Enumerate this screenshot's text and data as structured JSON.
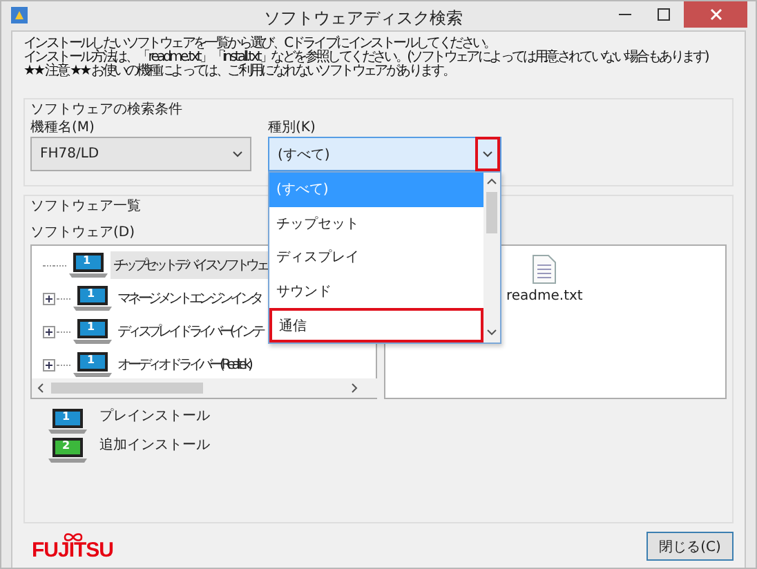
{
  "window": {
    "title": "ソフトウェアディスク検索"
  },
  "instructions": [
    "インストールしたいソフトウェアを一覧から選び、Cドライブにインストールしてください。",
    "インストール方法は、「readme.txt」「install.txt」などを参照してください。(ソフトウェアによっては用意されていない場合もあります)",
    "★★ 注意 ★★ お使いの機種によっては、ご利用になれないソフトウェアがあります。"
  ],
  "search": {
    "title": "ソフトウェアの検索条件",
    "model": {
      "label": "機種名(M)",
      "value": "FH78/LD"
    },
    "category": {
      "label": "種別(K)",
      "value": "(すべて)",
      "open": true,
      "button_highlighted": true,
      "options": [
        {
          "label": "(すべて)",
          "selected": true,
          "highlighted": false
        },
        {
          "label": "チップセット",
          "selected": false,
          "highlighted": false
        },
        {
          "label": "ディスプレイ",
          "selected": false,
          "highlighted": false
        },
        {
          "label": "サウンド",
          "selected": false,
          "highlighted": false
        },
        {
          "label": "通信",
          "selected": false,
          "highlighted": true
        }
      ]
    }
  },
  "software": {
    "title": "ソフトウェア一覧",
    "label": "ソフトウェア(D)",
    "tree": [
      {
        "label": "チップセットデバイスソフトウェ",
        "badge": "1",
        "selected": true
      },
      {
        "label": "マネージメントエンジンインタ",
        "badge": "1",
        "selected": false,
        "expanded": false
      },
      {
        "label": "ディスプレイドライバー(インテ",
        "badge": "1",
        "selected": false,
        "expanded": false
      },
      {
        "label": "オーディオドライバー(Realtek)",
        "badge": "1",
        "selected": false,
        "expanded": false
      }
    ],
    "files": [
      {
        "name": "readme.txt"
      }
    ],
    "legend": [
      {
        "badge": "1",
        "color": "#1e90d0",
        "label": "プレインストール"
      },
      {
        "badge": "2",
        "color": "#3cb83c",
        "label": "追加インストール"
      }
    ]
  },
  "footer": {
    "logo": "FUJITSU",
    "close_button": "閉じる(C)"
  }
}
